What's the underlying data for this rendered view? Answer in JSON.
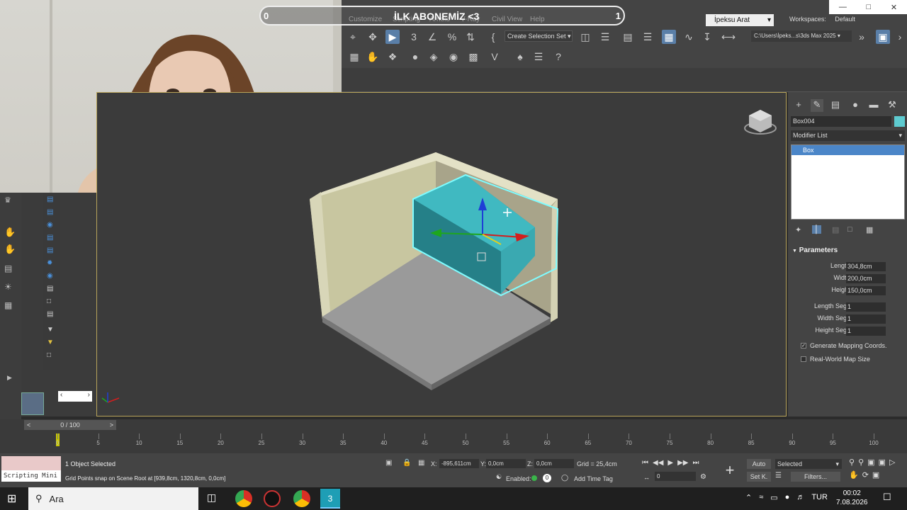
{
  "overlay": {
    "left_count": "0",
    "title": "İLK ABONEMİZ <3",
    "right_count": "1"
  },
  "menu": {
    "items": [
      "Customize",
      "Scripting",
      "Arnold",
      "V-Ray",
      "Civil View",
      "Help"
    ]
  },
  "user": {
    "name": "İpeksu Arat"
  },
  "workspaces": {
    "label": "Workspaces:",
    "value": "Default"
  },
  "toolbar": {
    "selection_set": "Create Selection Set",
    "path": "C:\\Users\\İpeks...s\\3ds Max 2025"
  },
  "panel": {
    "object_name": "Box004",
    "modifier_list": "Modifier List",
    "stack_item": "Box",
    "parameters_title": "Parameters",
    "params": [
      {
        "label": "Length:",
        "value": "304,8cm"
      },
      {
        "label": "Width:",
        "value": "200,0cm"
      },
      {
        "label": "Height:",
        "value": "150,0cm"
      },
      {
        "label": "Length Segs:",
        "value": "1"
      },
      {
        "label": "Width Segs:",
        "value": "1"
      },
      {
        "label": "Height Segs:",
        "value": "1"
      }
    ],
    "gen_mapping": "Generate Mapping Coords.",
    "real_world": "Real-World Map Size",
    "colors": {
      "object": "#5ecbd0"
    }
  },
  "timeline": {
    "slider": "0 / 100",
    "ticks": [
      "0",
      "5",
      "10",
      "15",
      "20",
      "25",
      "30",
      "35",
      "40",
      "45",
      "50",
      "55",
      "60",
      "65",
      "70",
      "75",
      "80",
      "85",
      "90",
      "95",
      "100"
    ]
  },
  "status": {
    "selected": "1 Object Selected",
    "prompt": "Grid Points snap on Scene Root at [939,8cm, 1320,8cm, 0,0cm]",
    "script": "Scripting Mini",
    "x_label": "X:",
    "x_value": "-895,611cm",
    "y_label": "Y:",
    "y_value": "0,0cm",
    "z_label": "Z:",
    "z_value": "0,0cm",
    "grid": "Grid = 25,4cm",
    "auto": "Auto",
    "setk": "Set K.",
    "selected_dd": "Selected",
    "filters": "Filters...",
    "enabled": "Enabled:",
    "add_time_tag": "Add Time Tag",
    "frame": "0"
  },
  "taskbar": {
    "search": "Ara",
    "lang": "TUR",
    "time": "00:02",
    "date": "7.08.2026"
  }
}
